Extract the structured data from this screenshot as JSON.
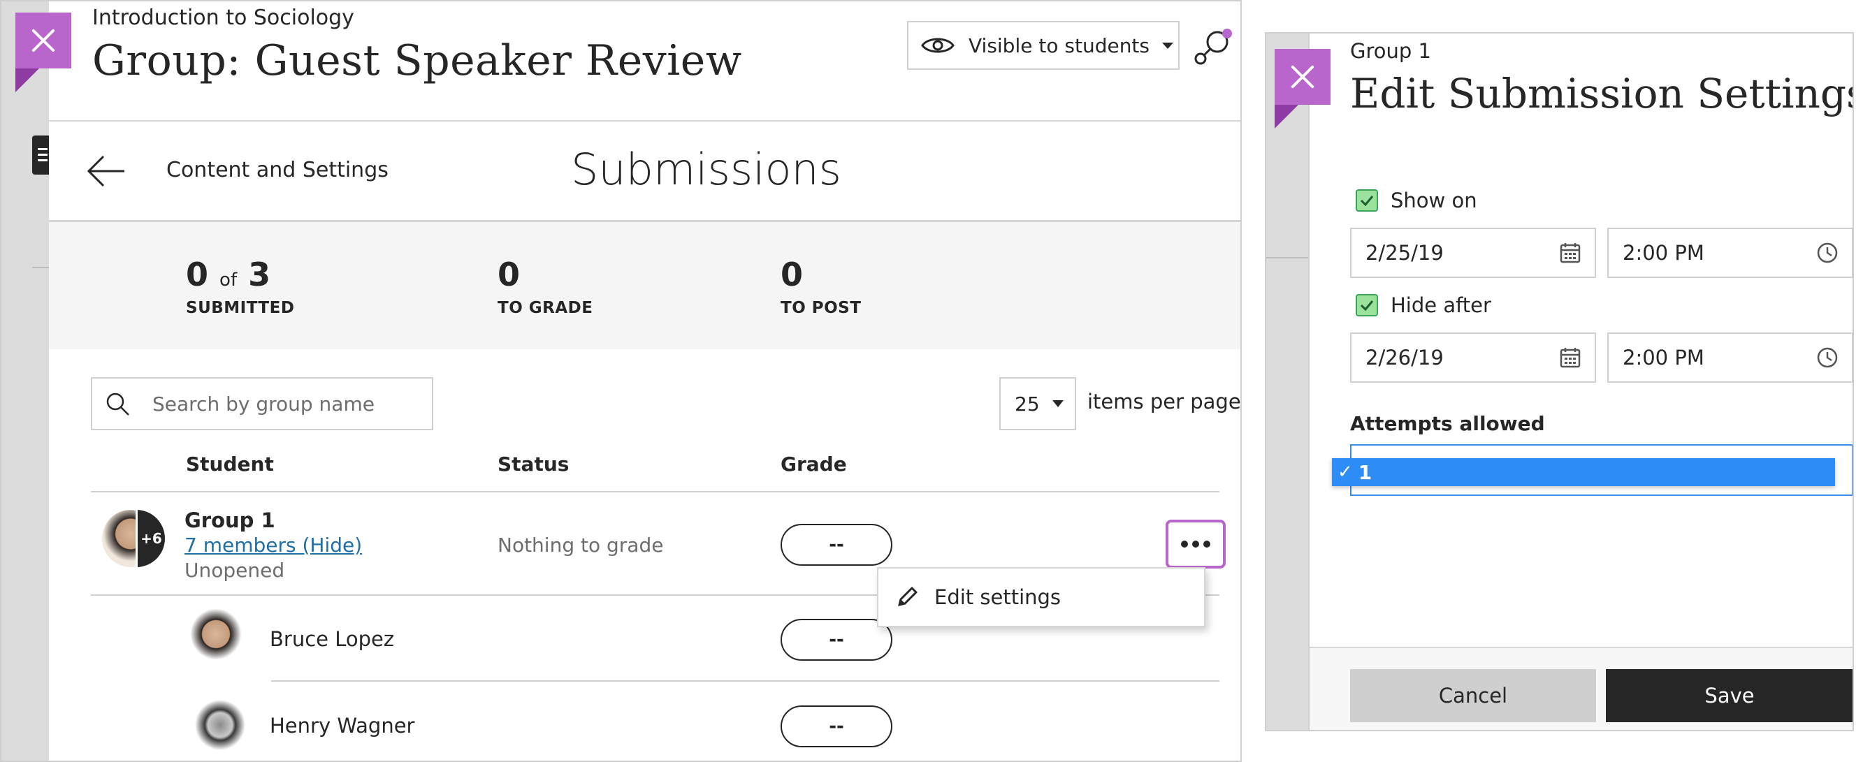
{
  "left": {
    "course_name": "Introduction to Sociology",
    "page_title": "Group: Guest Speaker Review",
    "visibility": {
      "label": "Visible to students",
      "icon": "eye-icon"
    },
    "subnav": {
      "back_label": "Content and Settings",
      "section_title": "Submissions"
    },
    "stats": {
      "submitted": {
        "count": "0",
        "of_word": "of",
        "total": "3",
        "label": "SUBMITTED"
      },
      "to_grade": {
        "count": "0",
        "label": "TO GRADE"
      },
      "to_post": {
        "count": "0",
        "label": "TO POST"
      }
    },
    "search": {
      "placeholder": "Search by group name"
    },
    "pagination": {
      "per_page": "25",
      "label": "items per page"
    },
    "columns": {
      "student": "Student",
      "status": "Status",
      "grade": "Grade"
    },
    "group_row": {
      "name": "Group 1",
      "members_link": "7 members (Hide)",
      "state": "Unopened",
      "status": "Nothing to grade",
      "grade": "--",
      "avatar_extra": "+6"
    },
    "members": [
      {
        "name": "Bruce Lopez",
        "grade": "--"
      },
      {
        "name": "Henry Wagner",
        "grade": "--"
      }
    ],
    "context_menu": {
      "edit_settings": "Edit settings",
      "icon": "pencil-icon"
    }
  },
  "right": {
    "group": "Group 1",
    "title": "Edit Submission Settings",
    "show_on": {
      "label": "Show on",
      "checked": true,
      "date": "2/25/19",
      "time": "2:00 PM"
    },
    "hide_after": {
      "label": "Hide after",
      "checked": true,
      "date": "2/26/19",
      "time": "2:00 PM"
    },
    "attempts": {
      "label": "Attempts allowed",
      "selected": "1",
      "check_mark": "✓"
    },
    "buttons": {
      "cancel": "Cancel",
      "save": "Save"
    }
  },
  "colors": {
    "accent_purple": "#b866cc",
    "checkbox_green": "#9be39d",
    "link_blue": "#1f6fa8",
    "select_blue": "#2e8cf7",
    "save_dark": "#262626"
  }
}
